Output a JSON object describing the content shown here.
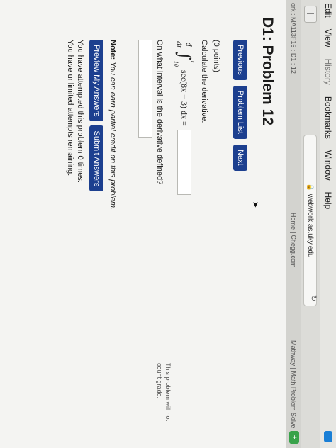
{
  "menubar": {
    "edit": "Edit",
    "view": "View",
    "history": "History",
    "bookmarks": "Bookmarks",
    "window": "Window",
    "help": "Help"
  },
  "browser": {
    "url": "webwork.as.uky.edu",
    "tab_left": "ork : MA113F16 : D1 : 12",
    "tab_mid": "Home | Chegg.com",
    "tab_right": "Mathway | Math Problem Solve"
  },
  "problem": {
    "title": "D1: Problem 12",
    "nav": {
      "previous": "Previous",
      "list": "Problem List",
      "next": "Next"
    },
    "points": "(0 points)",
    "instruction": "Calculate the derivative.",
    "equation": {
      "d_num": "d",
      "d_den": "dt",
      "upper_limit": "t",
      "lower_limit": "10",
      "integrand": "sec(8x − 3) dx ="
    },
    "question2": "On what interval is the derivative defined?",
    "note_label": "Note:",
    "note_text": " You can earn partial credit on this problem.",
    "preview_button": "Preview My Answers",
    "submit_button": "Submit Answers",
    "attempts_line1": "You have attempted this problem 0 times.",
    "attempts_line2": "You have unlimited attempts remaining.",
    "side_note": "This problem will not count grade."
  }
}
